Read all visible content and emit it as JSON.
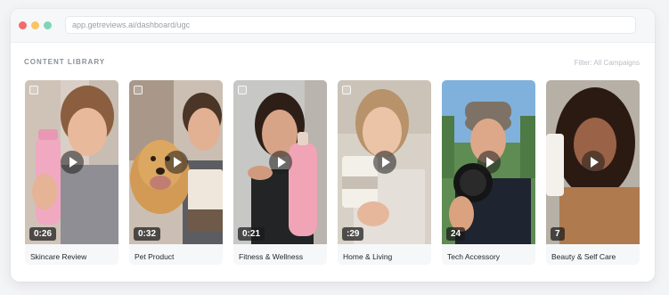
{
  "browser": {
    "url": "app.getreviews.ai/dashboard/ugc"
  },
  "library": {
    "title": "CONTENT LIBRARY",
    "filter": "Filter: All Campaigns"
  },
  "videos": [
    {
      "duration": "0:26",
      "label": "Skincare Review"
    },
    {
      "duration": "0:32",
      "label": "Pet Product"
    },
    {
      "duration": "0:21",
      "label": "Fitness & Wellness"
    },
    {
      "duration": ":29",
      "label": "Home & Living"
    },
    {
      "duration": "24",
      "label": "Tech Accessory"
    },
    {
      "duration": "7",
      "label": "Beauty & Self Care"
    }
  ],
  "colors": {
    "dot_red": "#f36c6c",
    "dot_yellow": "#f8c565",
    "dot_green": "#7fd6b4"
  }
}
